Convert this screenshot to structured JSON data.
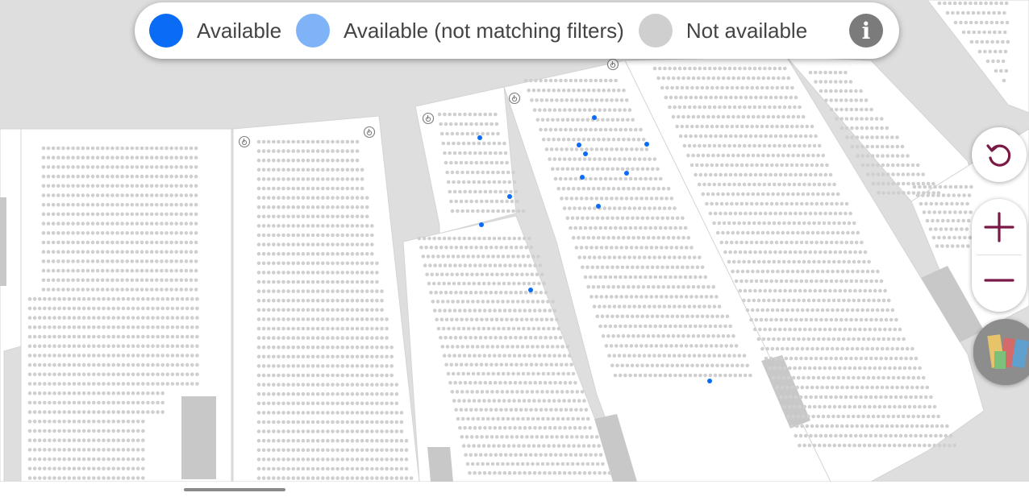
{
  "legend": {
    "items": [
      {
        "label": "Available",
        "color": "#0a6cf5"
      },
      {
        "label": "Available (not matching filters)",
        "color": "#7fb3f8"
      },
      {
        "label": "Not available",
        "color": "#cfcfcf"
      }
    ],
    "info_icon": "info-icon"
  },
  "controls": {
    "reset_icon": "reset-view-icon",
    "zoom_in_icon": "plus-icon",
    "zoom_out_icon": "minus-icon",
    "venue_thumbnail_icon": "venue-map-thumbnail"
  },
  "colors": {
    "available": "#0a6cf5",
    "available_not_matching": "#7fb3f8",
    "not_available": "#cfcfcf",
    "accent": "#7a1846",
    "venue_background": "#dedede",
    "section_fill": "#ffffff"
  }
}
